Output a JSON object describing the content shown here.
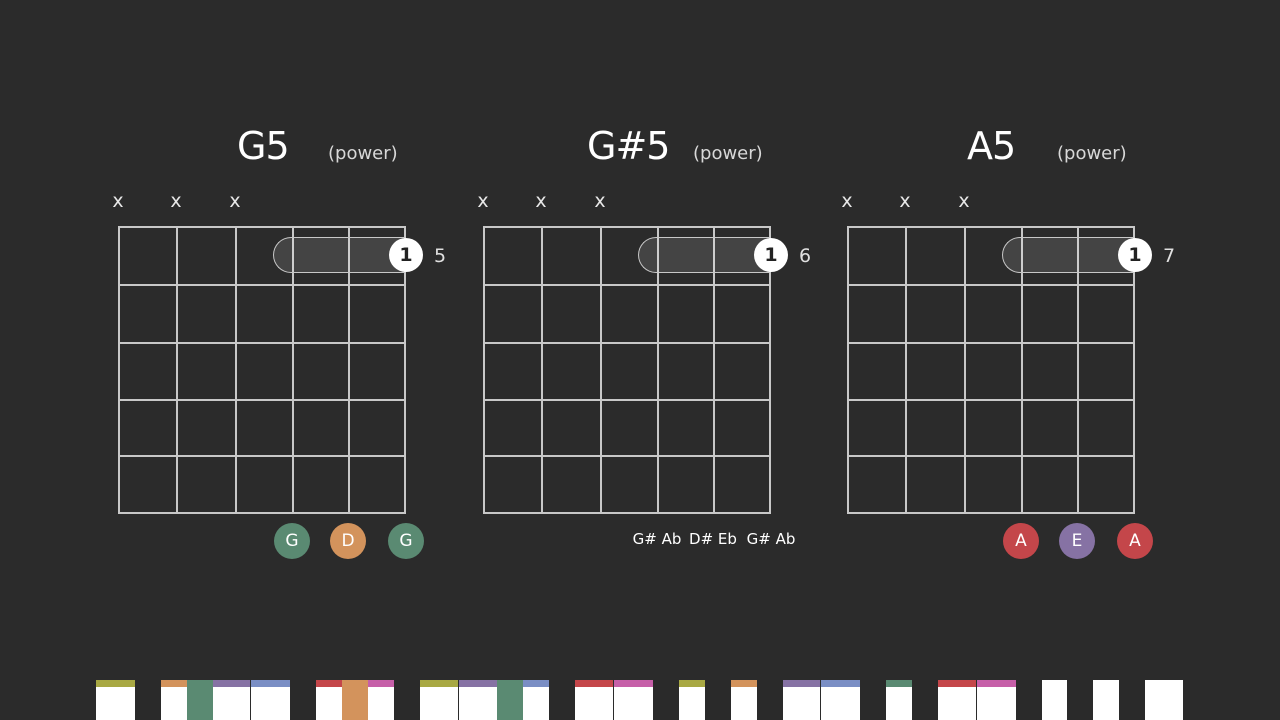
{
  "chords": [
    {
      "name": "G5",
      "type": "(power)",
      "muted": [
        "x",
        "x",
        "x"
      ],
      "finger": "1",
      "fret": "5",
      "notes": [
        {
          "label": "G",
          "color": "#5a8a72"
        },
        {
          "label": "D",
          "color": "#d3935c"
        },
        {
          "label": "G",
          "color": "#5a8a72"
        }
      ]
    },
    {
      "name": "G#5",
      "type": "(power)",
      "muted": [
        "x",
        "x",
        "x"
      ],
      "finger": "1",
      "fret": "6",
      "notes": [
        {
          "label": "G# Ab"
        },
        {
          "label": "D# Eb"
        },
        {
          "label": "G# Ab"
        }
      ]
    },
    {
      "name": "A5",
      "type": "(power)",
      "muted": [
        "x",
        "x",
        "x"
      ],
      "finger": "1",
      "fret": "7",
      "notes": [
        {
          "label": "A",
          "color": "#c4464a"
        },
        {
          "label": "E",
          "color": "#8672a4"
        },
        {
          "label": "A",
          "color": "#c4464a"
        }
      ]
    }
  ],
  "piano": {
    "white_key_colors": [
      "#a8a843",
      "#d3935c",
      "#8672a4",
      "#7a8ec4",
      "#c4464a",
      "#c65fa8",
      "#a8a843",
      "#8672a4",
      "#7a8ec4",
      "#c4464a",
      "#c65fa8",
      "#a8a843",
      "#d3935c",
      "#8672a4",
      "#7a8ec4",
      "#5a8a72",
      "#c4464a",
      "#c65fa8"
    ],
    "black_key_colors": [
      null,
      "#5a8a72",
      null,
      "#d3935c",
      null,
      "#5a8a72",
      null,
      null,
      null,
      null
    ]
  }
}
